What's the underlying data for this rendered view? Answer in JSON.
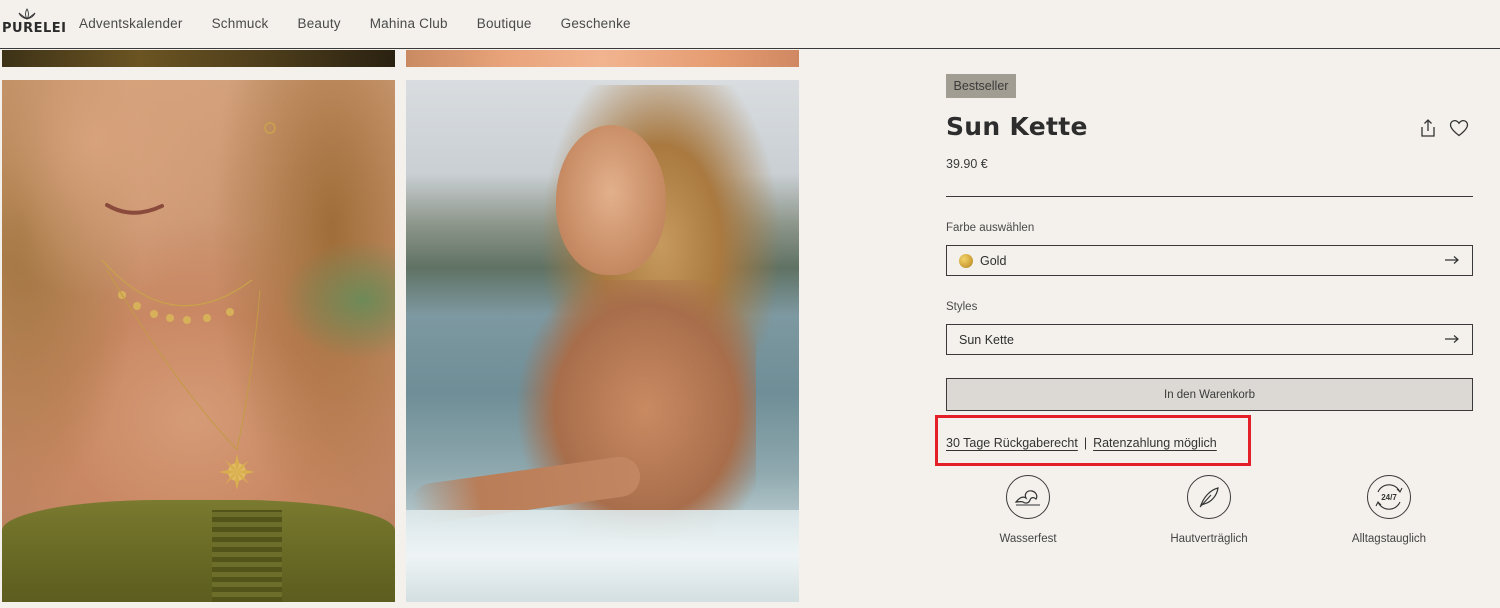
{
  "header": {
    "logo_text": "PURELEI",
    "nav": [
      "Adventskalender",
      "Schmuck",
      "Beauty",
      "Mahina Club",
      "Boutique",
      "Geschenke"
    ]
  },
  "product": {
    "badge": "Bestseller",
    "title": "Sun Kette",
    "price": "39.90 €",
    "color_label": "Farbe auswählen",
    "color_value": "Gold",
    "styles_label": "Styles",
    "styles_value": "Sun Kette",
    "cart_button": "In den Warenkorb",
    "links": {
      "returns": "30 Tage Rückgaberecht",
      "separator": "|",
      "installments": "Ratenzahlung möglich"
    },
    "features": [
      {
        "label": "Wasserfest",
        "icon": "wave-icon"
      },
      {
        "label": "Hautverträglich",
        "icon": "feather-icon"
      },
      {
        "label": "Alltagstauglich",
        "icon": "24-7-icon",
        "icon_text": "24/7"
      }
    ]
  },
  "icons": {
    "share": "share-icon",
    "wishlist": "heart-icon",
    "arrow": "arrow-right-icon"
  },
  "colors": {
    "background": "#f4f1ed",
    "badge": "#a29d92",
    "cart_button": "#dcd9d4",
    "highlight_box": "#e3202a",
    "gold_swatch": "#cfa33a"
  }
}
